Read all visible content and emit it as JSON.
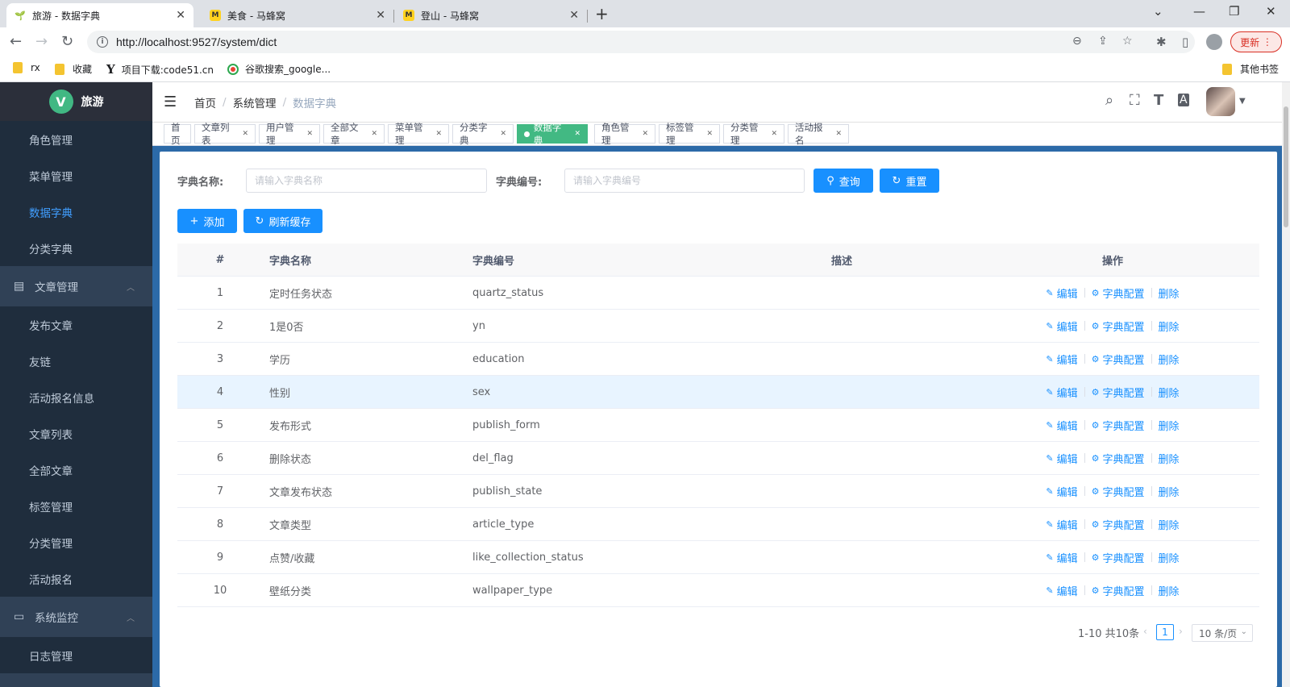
{
  "browser": {
    "tabs": [
      {
        "title": "旅游 - 数据字典",
        "active": true
      },
      {
        "title": "美食 - 马蜂窝",
        "active": false
      },
      {
        "title": "登山 - 马蜂窝",
        "active": false
      }
    ],
    "url": "http://localhost:9527/system/dict",
    "update_label": "更新",
    "bookmarks": [
      "rx",
      "收藏",
      "项目下载:code51.cn",
      "谷歌搜索_google..."
    ],
    "other_bookmarks": "其他书签"
  },
  "app": {
    "logo_letter": "V",
    "title": "旅游"
  },
  "sidebar": {
    "items": [
      {
        "label": "角色管理",
        "type": "item"
      },
      {
        "label": "菜单管理",
        "type": "item"
      },
      {
        "label": "数据字典",
        "type": "item",
        "active": true
      },
      {
        "label": "分类字典",
        "type": "item"
      },
      {
        "label": "文章管理",
        "type": "group"
      },
      {
        "label": "发布文章",
        "type": "item"
      },
      {
        "label": "友链",
        "type": "item"
      },
      {
        "label": "活动报名信息",
        "type": "item"
      },
      {
        "label": "文章列表",
        "type": "item"
      },
      {
        "label": "全部文章",
        "type": "item"
      },
      {
        "label": "标签管理",
        "type": "item"
      },
      {
        "label": "分类管理",
        "type": "item"
      },
      {
        "label": "活动报名",
        "type": "item"
      },
      {
        "label": "系统监控",
        "type": "group"
      },
      {
        "label": "日志管理",
        "type": "item"
      }
    ]
  },
  "breadcrumb": [
    "首页",
    "系统管理",
    "数据字典"
  ],
  "tags": [
    {
      "label": "首页",
      "closable": false
    },
    {
      "label": "文章列表",
      "closable": true
    },
    {
      "label": "用户管理",
      "closable": true
    },
    {
      "label": "全部文章",
      "closable": true
    },
    {
      "label": "菜单管理",
      "closable": true
    },
    {
      "label": "分类字典",
      "closable": true
    },
    {
      "label": "数据字典",
      "closable": true,
      "active": true
    },
    {
      "label": "角色管理",
      "closable": true
    },
    {
      "label": "标签管理",
      "closable": true
    },
    {
      "label": "分类管理",
      "closable": true
    },
    {
      "label": "活动报名",
      "closable": true
    }
  ],
  "search": {
    "name_label": "字典名称:",
    "name_placeholder": "请输入字典名称",
    "code_label": "字典编号:",
    "code_placeholder": "请输入字典编号",
    "query_label": "查询",
    "reset_label": "重置"
  },
  "toolbar": {
    "add_label": "添加",
    "refresh_label": "刷新缓存"
  },
  "table": {
    "columns": [
      "#",
      "字典名称",
      "字典编号",
      "描述",
      "操作"
    ],
    "rows": [
      {
        "idx": "1",
        "name": "定时任务状态",
        "code": "quartz_status",
        "desc": ""
      },
      {
        "idx": "2",
        "name": "1是0否",
        "code": "yn",
        "desc": ""
      },
      {
        "idx": "3",
        "name": "学历",
        "code": "education",
        "desc": ""
      },
      {
        "idx": "4",
        "name": "性别",
        "code": "sex",
        "desc": ""
      },
      {
        "idx": "5",
        "name": "发布形式",
        "code": "publish_form",
        "desc": ""
      },
      {
        "idx": "6",
        "name": "删除状态",
        "code": "del_flag",
        "desc": ""
      },
      {
        "idx": "7",
        "name": "文章发布状态",
        "code": "publish_state",
        "desc": ""
      },
      {
        "idx": "8",
        "name": "文章类型",
        "code": "article_type",
        "desc": ""
      },
      {
        "idx": "9",
        "name": "点赞/收藏",
        "code": "like_collection_status",
        "desc": ""
      },
      {
        "idx": "10",
        "name": "壁纸分类",
        "code": "wallpaper_type",
        "desc": ""
      }
    ],
    "highlighted_row": 3,
    "ops": {
      "edit": "编辑",
      "config": "字典配置",
      "delete": "删除"
    }
  },
  "pagination": {
    "summary": "1-10 共10条",
    "current_page": "1",
    "page_size": "10 条/页"
  },
  "colors": {
    "primary": "#1890ff",
    "sidebar_bg": "#304156",
    "sidebar_sub_bg": "#1f2d3d",
    "tag_active": "#42b983"
  }
}
